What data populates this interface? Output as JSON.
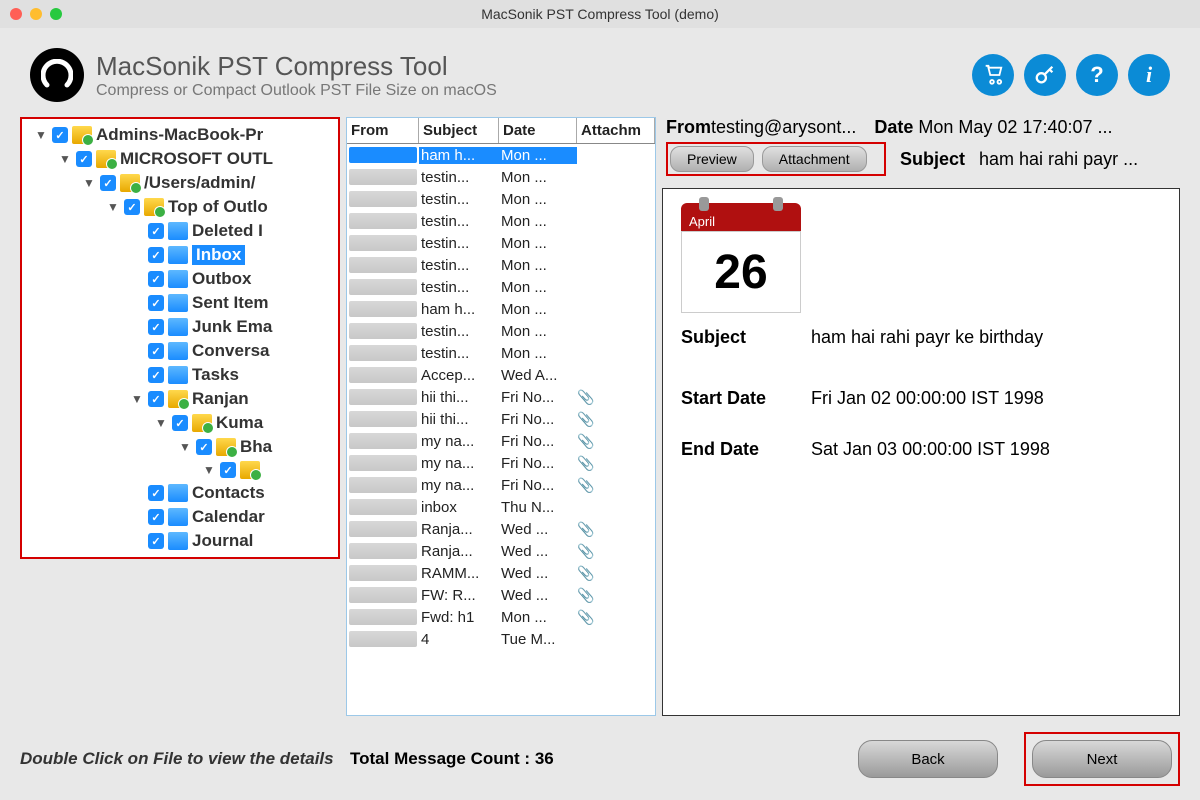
{
  "titlebar": {
    "text": "MacSonik PST Compress Tool (demo)"
  },
  "header": {
    "title": "MacSonik PST Compress Tool",
    "subtitle": "Compress or Compact Outlook PST File Size on macOS",
    "icons": [
      "cart",
      "key",
      "help",
      "info"
    ]
  },
  "tree": [
    {
      "indent": 0,
      "arrow": "▼",
      "folder": "yellow",
      "label": "Admins-MacBook-Pr"
    },
    {
      "indent": 1,
      "arrow": "▼",
      "folder": "yellow",
      "label": "MICROSOFT OUTL"
    },
    {
      "indent": 2,
      "arrow": "▼",
      "folder": "yellow",
      "label": "/Users/admin/"
    },
    {
      "indent": 3,
      "arrow": "▼",
      "folder": "yellow",
      "label": "Top of Outlo"
    },
    {
      "indent": 4,
      "arrow": "",
      "folder": "blue",
      "label": "Deleted I"
    },
    {
      "indent": 4,
      "arrow": "",
      "folder": "blue",
      "label": "Inbox",
      "selected": true
    },
    {
      "indent": 4,
      "arrow": "",
      "folder": "blue",
      "label": "Outbox"
    },
    {
      "indent": 4,
      "arrow": "",
      "folder": "blue",
      "label": "Sent Item"
    },
    {
      "indent": 4,
      "arrow": "",
      "folder": "blue",
      "label": "Junk Ema"
    },
    {
      "indent": 4,
      "arrow": "",
      "folder": "blue",
      "label": "Conversa"
    },
    {
      "indent": 4,
      "arrow": "",
      "folder": "blue",
      "label": "Tasks"
    },
    {
      "indent": 4,
      "arrow": "▼",
      "folder": "yellow",
      "label": "Ranjan"
    },
    {
      "indent": 5,
      "arrow": "▼",
      "folder": "yellow",
      "label": "Kuma"
    },
    {
      "indent": 6,
      "arrow": "▼",
      "folder": "yellow",
      "label": "Bha"
    },
    {
      "indent": 7,
      "arrow": "▼",
      "folder": "yellow",
      "label": ""
    },
    {
      "indent": 4,
      "arrow": "",
      "folder": "blue",
      "label": "Contacts"
    },
    {
      "indent": 4,
      "arrow": "",
      "folder": "blue",
      "label": "Calendar"
    },
    {
      "indent": 4,
      "arrow": "",
      "folder": "blue",
      "label": "Journal"
    }
  ],
  "msgCols": {
    "from": "From",
    "subject": "Subject",
    "date": "Date",
    "attach": "Attachm"
  },
  "msgs": [
    {
      "subject": "ham h...",
      "date": "Mon ...",
      "att": false,
      "selected": true
    },
    {
      "subject": "testin...",
      "date": "Mon ...",
      "att": false
    },
    {
      "subject": "testin...",
      "date": "Mon ...",
      "att": false
    },
    {
      "subject": "testin...",
      "date": "Mon ...",
      "att": false
    },
    {
      "subject": "testin...",
      "date": "Mon ...",
      "att": false
    },
    {
      "subject": "testin...",
      "date": "Mon ...",
      "att": false
    },
    {
      "subject": "testin...",
      "date": "Mon ...",
      "att": false
    },
    {
      "subject": "ham h...",
      "date": "Mon ...",
      "att": false
    },
    {
      "subject": "testin...",
      "date": "Mon ...",
      "att": false
    },
    {
      "subject": "testin...",
      "date": "Mon ...",
      "att": false
    },
    {
      "subject": "Accep...",
      "date": "Wed A...",
      "att": false
    },
    {
      "subject": "hii thi...",
      "date": "Fri No...",
      "att": true
    },
    {
      "subject": "hii thi...",
      "date": "Fri No...",
      "att": true
    },
    {
      "subject": "my na...",
      "date": "Fri No...",
      "att": true
    },
    {
      "subject": "my na...",
      "date": "Fri No...",
      "att": true
    },
    {
      "subject": "my na...",
      "date": "Fri No...",
      "att": true
    },
    {
      "subject": "inbox",
      "date": "Thu N...",
      "att": false
    },
    {
      "subject": "Ranja...",
      "date": "Wed ...",
      "att": true
    },
    {
      "subject": "Ranja...",
      "date": "Wed ...",
      "att": true
    },
    {
      "subject": "RAMM...",
      "date": "Wed ...",
      "att": true
    },
    {
      "subject": "FW: R...",
      "date": "Wed ...",
      "att": true
    },
    {
      "subject": "Fwd: h1",
      "date": "Mon ...",
      "att": true
    },
    {
      "subject": "4",
      "date": "Tue M...",
      "att": false
    }
  ],
  "preview": {
    "fromLabel": "From",
    "from": "testing@arysont...",
    "dateLabel": "Date",
    "date": "Mon May 02 17:40:07 ...",
    "subjectLabel": "Subject",
    "subjectShort": "ham hai rahi payr ...",
    "tabs": {
      "preview": "Preview",
      "attachment": "Attachment"
    },
    "calendar": {
      "month": "April",
      "day": "26"
    },
    "body": {
      "subjectLabel": "Subject",
      "subject": "ham hai rahi payr ke birthday",
      "startLabel": "Start Date",
      "start": "Fri Jan 02 00:00:00 IST 1998",
      "endLabel": "End Date",
      "end": "Sat Jan 03 00:00:00 IST 1998"
    }
  },
  "footer": {
    "hint": "Double Click on File to view the details",
    "countLabel": "Total Message Count : ",
    "count": "36",
    "back": "Back",
    "next": "Next"
  }
}
